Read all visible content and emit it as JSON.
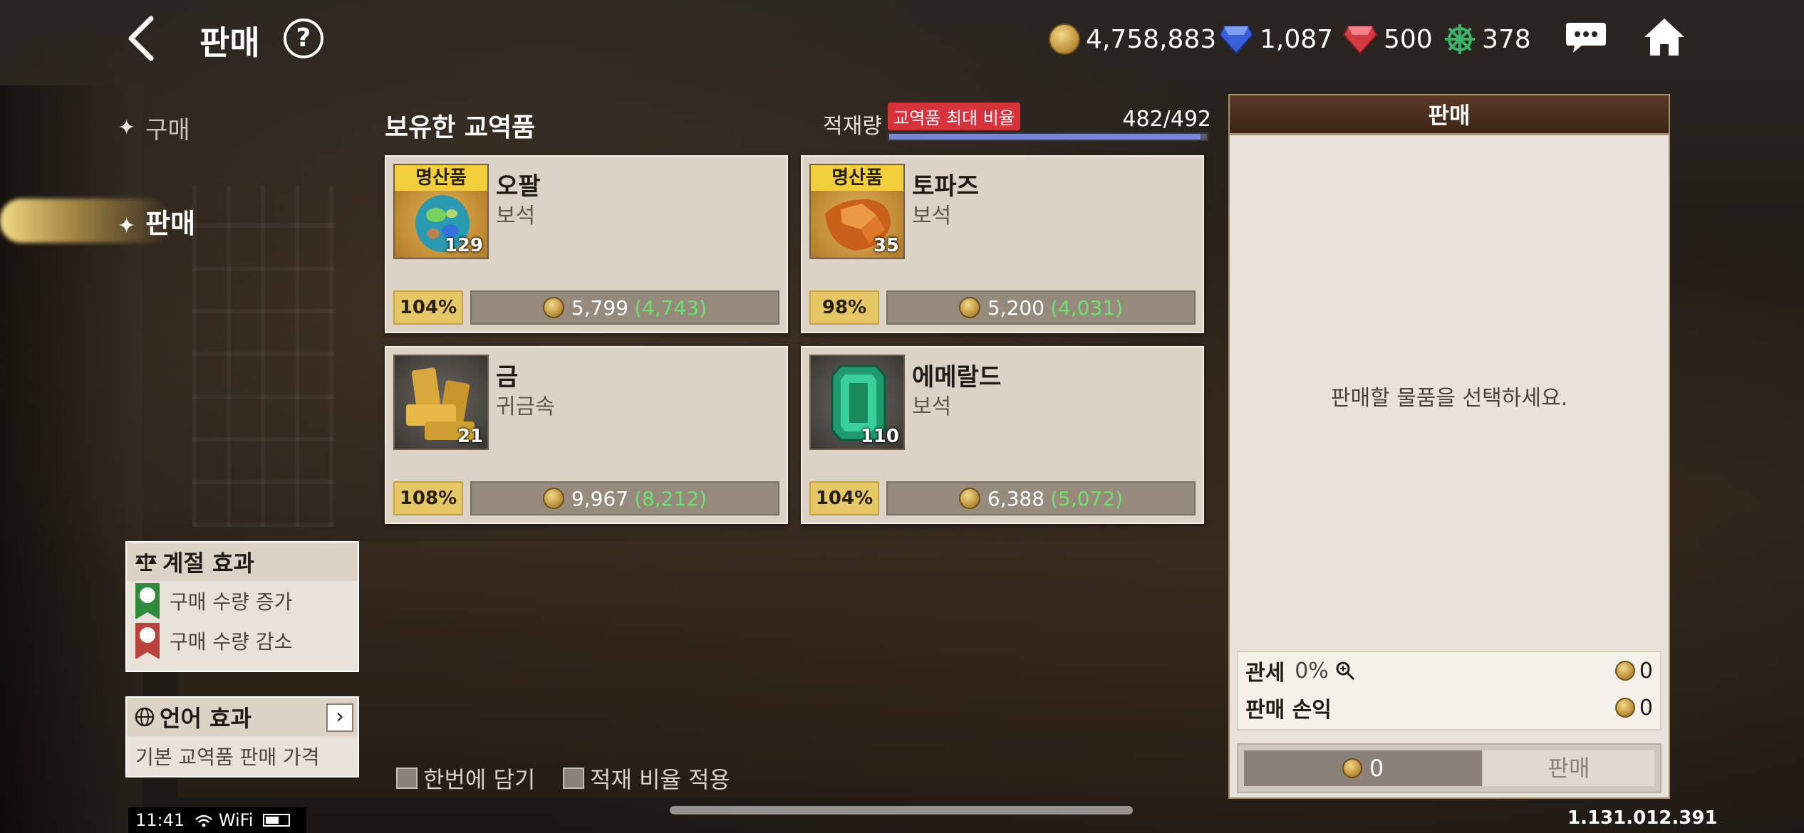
{
  "header": {
    "title": "판매",
    "help_label": "?"
  },
  "currencies": [
    {
      "icon": "gold-coin-icon",
      "value": "4,758,883"
    },
    {
      "icon": "blue-gem-icon",
      "value": "1,087"
    },
    {
      "icon": "red-gem-icon",
      "value": "500"
    },
    {
      "icon": "ship-wheel-icon",
      "value": "378"
    }
  ],
  "tabs": {
    "buy": "구매",
    "sell": "판매"
  },
  "cargo": {
    "section_title": "보유한 교역품",
    "label": "적재량",
    "badge": "교역품 최대 비율",
    "count": "482/492",
    "fill_fraction": 0.98
  },
  "items": [
    {
      "badge": "명산품",
      "name": "오팔",
      "category": "보석",
      "qty": "129",
      "pct": "104%",
      "price": "5,799",
      "original": "(4,743)"
    },
    {
      "badge": "명산품",
      "name": "토파즈",
      "category": "보석",
      "qty": "35",
      "pct": "98%",
      "price": "5,200",
      "original": "(4,031)"
    },
    {
      "badge": "",
      "name": "금",
      "category": "귀금속",
      "qty": "21",
      "pct": "108%",
      "price": "9,967",
      "original": "(8,212)"
    },
    {
      "badge": "",
      "name": "에메랄드",
      "category": "보석",
      "qty": "110",
      "pct": "104%",
      "price": "6,388",
      "original": "(5,072)"
    }
  ],
  "season": {
    "title": "계절 효과",
    "increase": "구매 수량 증가",
    "decrease": "구매 수량 감소"
  },
  "language": {
    "title": "언어 효과",
    "desc": "기본 교역품 판매 가격",
    "arrow": "›"
  },
  "options": {
    "bulk": "한번에 담기",
    "ratio": "적재 비율 적용"
  },
  "sell_panel": {
    "title": "판매",
    "empty": "판매할 물품을 선택하세요.",
    "tax_label": "관세",
    "tax_rate": "0%",
    "tax_amount": "0",
    "profit_label": "판매 손익",
    "profit_amount": "0",
    "total": "0",
    "button": "판매"
  },
  "status": {
    "time": "11:41",
    "network": "WiFi"
  },
  "version": "1.131.012.391",
  "colors": {
    "badge_yellow": "#f2cf3a",
    "cargo_red": "#d6333b",
    "original_price_green": "#6ee06e"
  }
}
